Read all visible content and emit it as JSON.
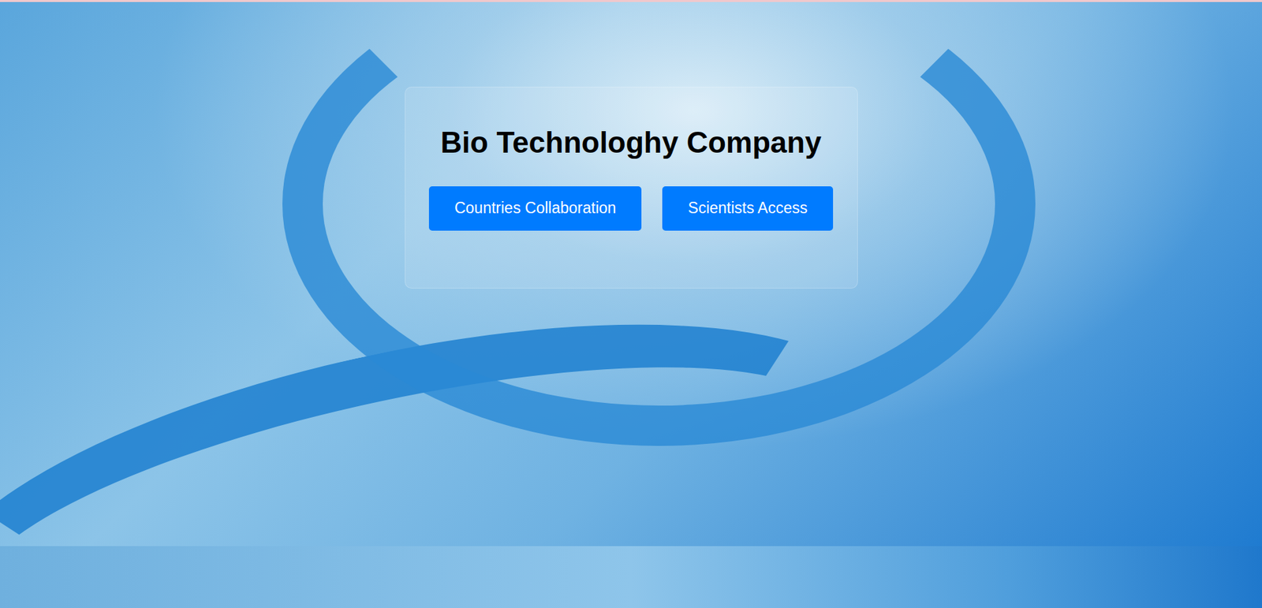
{
  "page": {
    "title": "Bio Technologhy Company"
  },
  "buttons": [
    {
      "label": "Countries Collaboration"
    },
    {
      "label": "Scientists Access"
    }
  ]
}
